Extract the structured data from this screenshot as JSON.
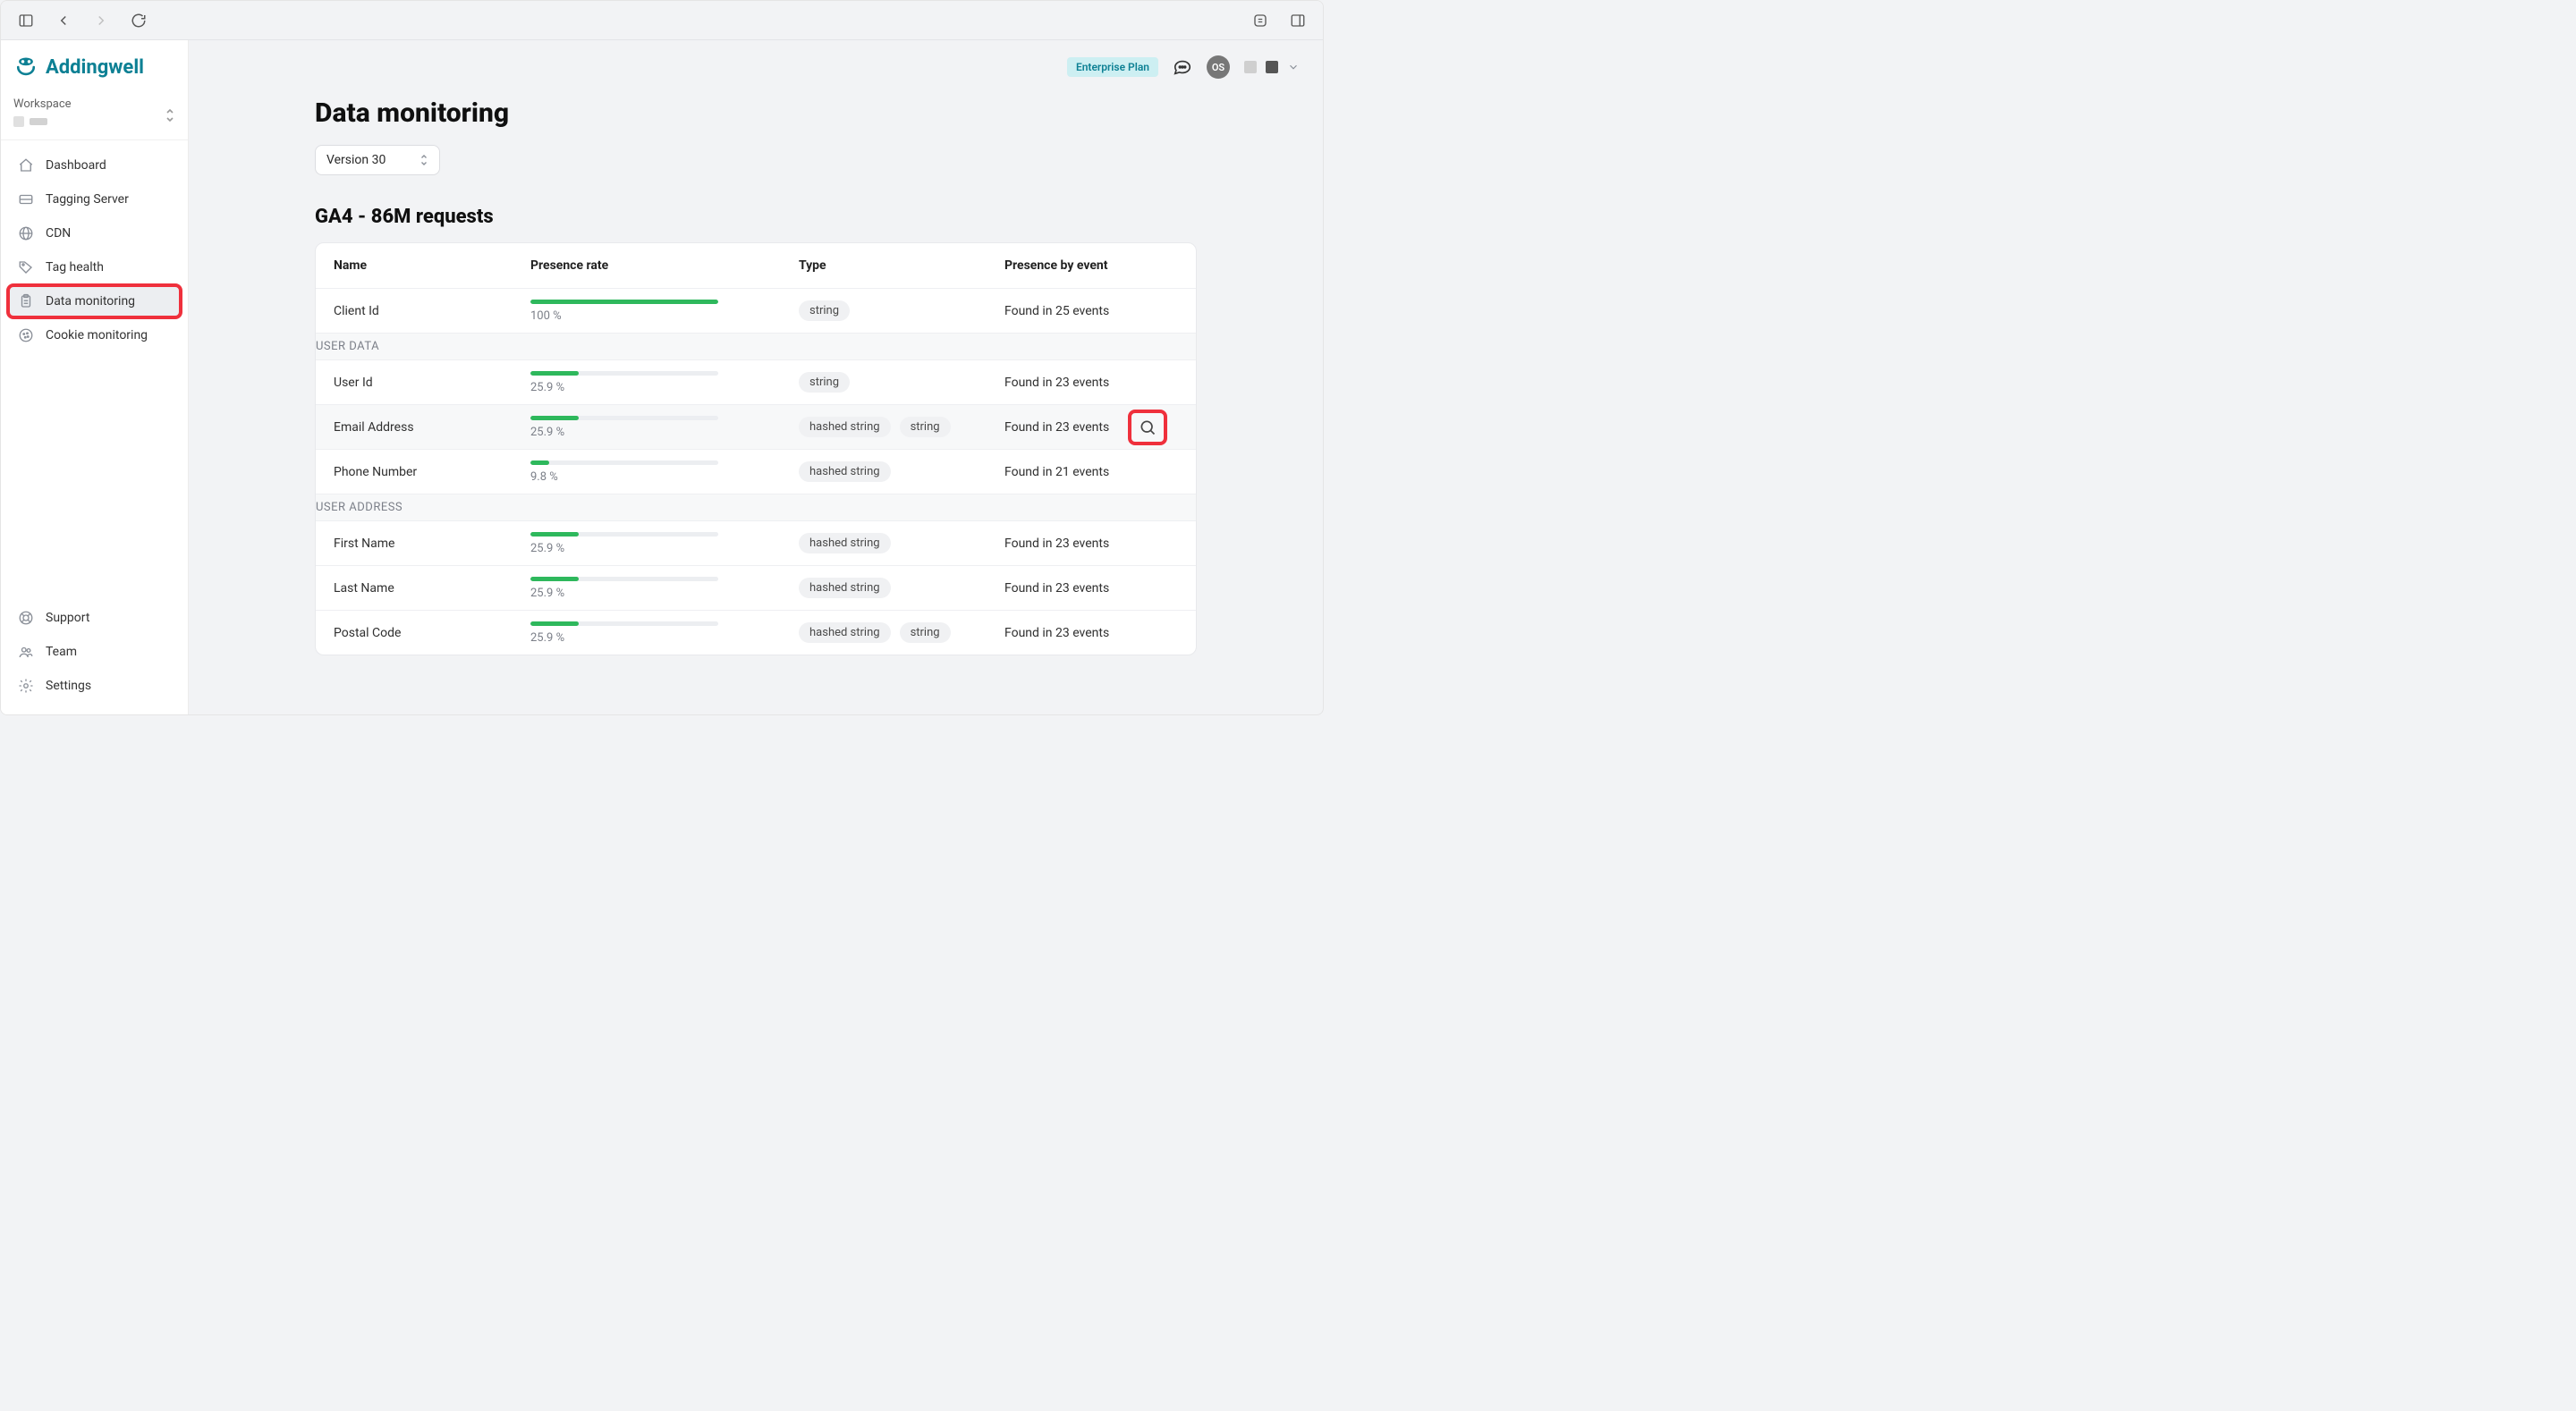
{
  "plan": "Enterprise Plan",
  "avatar": "OS",
  "brand": "Addingwell",
  "workspace_label": "Workspace",
  "sidebar": {
    "items": [
      {
        "label": "Dashboard"
      },
      {
        "label": "Tagging Server"
      },
      {
        "label": "CDN"
      },
      {
        "label": "Tag health"
      },
      {
        "label": "Data monitoring"
      },
      {
        "label": "Cookie monitoring"
      }
    ],
    "bottom": [
      {
        "label": "Support"
      },
      {
        "label": "Team"
      },
      {
        "label": "Settings"
      }
    ]
  },
  "page": {
    "title": "Data monitoring",
    "version": "Version 30",
    "section_title": "GA4 - 86M requests"
  },
  "table": {
    "headers": {
      "name": "Name",
      "presence": "Presence rate",
      "type": "Type",
      "events": "Presence by event"
    },
    "rows": [
      {
        "name": "Client Id",
        "pct": "100 %",
        "fill": 100,
        "types": [
          "string"
        ],
        "events": "Found in 25 events",
        "search": false,
        "hover": false
      },
      {
        "section": "USER DATA"
      },
      {
        "name": "User Id",
        "pct": "25.9 %",
        "fill": 25.9,
        "types": [
          "string"
        ],
        "events": "Found in 23 events",
        "search": false,
        "hover": false
      },
      {
        "name": "Email Address",
        "pct": "25.9 %",
        "fill": 25.9,
        "types": [
          "hashed string",
          "string"
        ],
        "events": "Found in 23 events",
        "search": true,
        "hover": true
      },
      {
        "name": "Phone Number",
        "pct": "9.8 %",
        "fill": 9.8,
        "types": [
          "hashed string"
        ],
        "events": "Found in 21 events",
        "search": false,
        "hover": false
      },
      {
        "section": "USER ADDRESS"
      },
      {
        "name": "First Name",
        "pct": "25.9 %",
        "fill": 25.9,
        "types": [
          "hashed string"
        ],
        "events": "Found in 23 events",
        "search": false,
        "hover": false
      },
      {
        "name": "Last Name",
        "pct": "25.9 %",
        "fill": 25.9,
        "types": [
          "hashed string"
        ],
        "events": "Found in 23 events",
        "search": false,
        "hover": false
      },
      {
        "name": "Postal Code",
        "pct": "25.9 %",
        "fill": 25.9,
        "types": [
          "hashed string",
          "string"
        ],
        "events": "Found in 23 events",
        "search": false,
        "hover": false
      }
    ]
  }
}
